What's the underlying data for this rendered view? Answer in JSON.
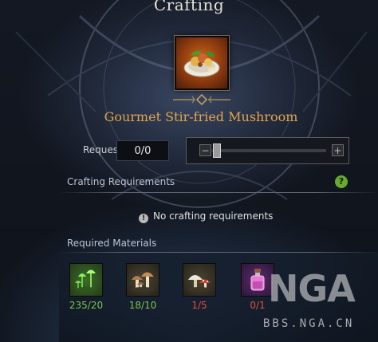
{
  "window": {
    "title": "Crafting"
  },
  "item": {
    "name": "Gourmet Stir-fried Mushroom",
    "icon": "stir-fried-dish-icon"
  },
  "request": {
    "label": "Request",
    "value": "0/0"
  },
  "slider": {
    "minus": "−",
    "plus": "+",
    "fraction": 0
  },
  "crafting_requirements": {
    "label": "Crafting Requirements",
    "help": "?",
    "info_icon": "!",
    "message": "No crafting requirements"
  },
  "materials": {
    "label": "Required Materials",
    "items": [
      {
        "icon": "green-glowing-mushroom-icon",
        "count": "235/20",
        "color": "#7ec34e"
      },
      {
        "icon": "brown-mushroom-cluster-icon",
        "count": "18/10",
        "color": "#7ec34e"
      },
      {
        "icon": "red-white-mushroom-icon",
        "count": "1/5",
        "color": "#e0503e"
      },
      {
        "icon": "pink-potion-bottle-icon",
        "count": "0/1",
        "color": "#e0503e"
      }
    ]
  },
  "watermark": {
    "logo": "NGA",
    "url": "BBS.NGA.CN"
  },
  "colors": {
    "accent": "#e4a44d",
    "ok": "#7ec34e",
    "bad": "#e0503e",
    "help": "#69a832"
  }
}
